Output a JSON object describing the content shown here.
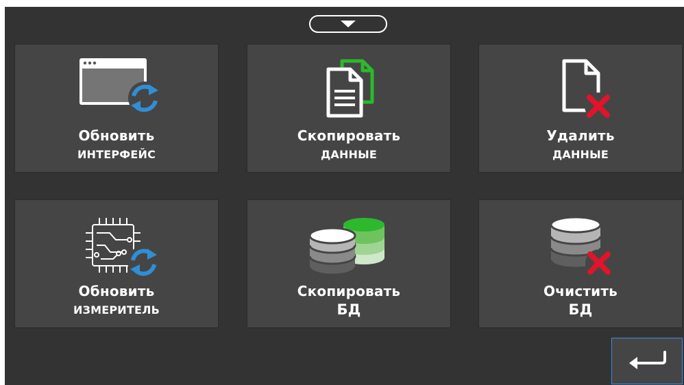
{
  "tiles": [
    {
      "line1": "Обновить",
      "line2": "интерфейс",
      "icon": "window-refresh-icon"
    },
    {
      "line1": "Скопировать",
      "line2": "данные",
      "icon": "copy-document-icon"
    },
    {
      "line1": "Удалить",
      "line2": "данные",
      "icon": "delete-document-icon"
    },
    {
      "line1": "Обновить",
      "line2": "измеритель",
      "icon": "chip-refresh-icon"
    },
    {
      "line1": "Скопировать",
      "line2": "БД",
      "icon": "copy-database-icon"
    },
    {
      "line1": "Очистить",
      "line2": "БД",
      "icon": "clear-database-icon"
    }
  ],
  "controls": {
    "collapse_icon": "chevron-down-icon",
    "back_icon": "return-arrow-icon"
  },
  "colors": {
    "background": "#333333",
    "tile": "#454545",
    "refresh_blue": "#2f8fd6",
    "copy_green": "#2db82d",
    "delete_red": "#e0142a",
    "back_border": "#3a8ee0"
  }
}
